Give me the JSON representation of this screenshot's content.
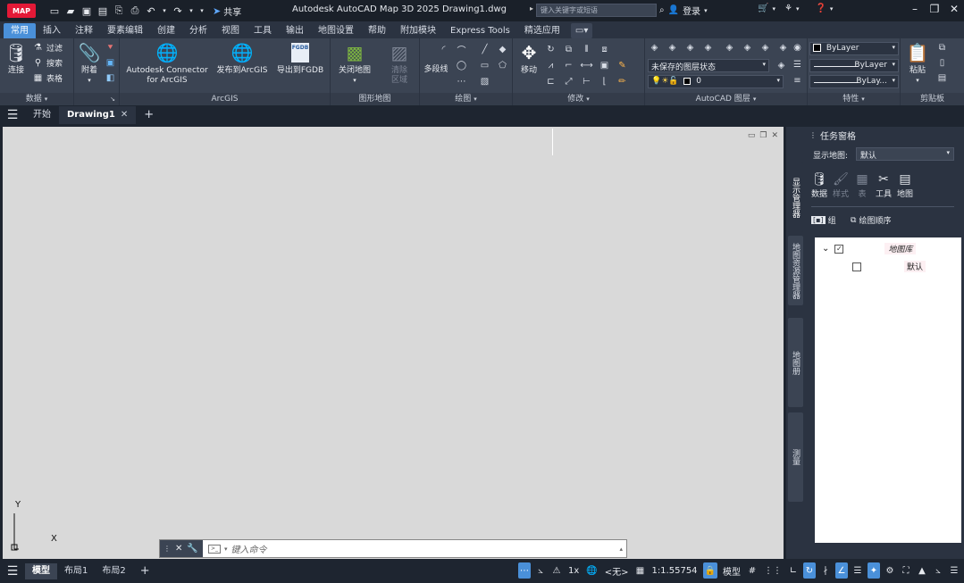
{
  "titlebar": {
    "logo": "MAP",
    "share_label": "共享",
    "window_title": "Autodesk AutoCAD Map 3D 2025    Drawing1.dwg",
    "search_placeholder": "键入关键字或短语",
    "login_label": "登录",
    "qat_icons": [
      "new-icon",
      "open-icon",
      "save-icon",
      "saveas-icon",
      "publish-icon",
      "plot-icon",
      "undo-icon",
      "redo-icon"
    ]
  },
  "ribbon_tabs": [
    "常用",
    "插入",
    "注释",
    "要素编辑",
    "创建",
    "分析",
    "视图",
    "工具",
    "输出",
    "地图设置",
    "帮助",
    "附加模块",
    "Express Tools",
    "精选应用"
  ],
  "ribbon": {
    "data_panel": {
      "title": "数据",
      "connect": "连接",
      "filter": "过滤",
      "search": "搜索",
      "table": "表格"
    },
    "attach_panel": {
      "attach": "附着"
    },
    "arcgis_panel": {
      "title": "ArcGIS",
      "connector": "Autodesk Connector",
      "connector2": "for ArcGIS",
      "publish": "发布到ArcGIS",
      "export": "导出到FGDB",
      "export_badge": "FGDB"
    },
    "mapbook_panel": {
      "title": "图形地图",
      "close_map": "关闭地图",
      "clear_region": "清除",
      "clear_region2": "区域"
    },
    "draw_panel": {
      "title": "绘图",
      "polyline": "多段线"
    },
    "modify_panel": {
      "title": "修改",
      "move": "移动"
    },
    "layers_panel": {
      "title": "AutoCAD 图层",
      "layer_state": "未保存的图层状态",
      "layer_current": "0"
    },
    "properties_panel": {
      "title": "特性",
      "color": "ByLayer",
      "linetype": "ByLayer",
      "lineweight": "ByLay..."
    },
    "clipboard_panel": {
      "title": "剪贴板",
      "paste": "粘贴"
    }
  },
  "filetabs": {
    "start": "开始",
    "drawing": "Drawing1"
  },
  "canvas": {
    "ucs_y": "Y",
    "ucs_x": "X",
    "cmd_placeholder": "键入命令"
  },
  "taskpane": {
    "title": "任务窗格",
    "display_map_label": "显示地图:",
    "display_map_value": "默认",
    "tools": [
      {
        "label": "数据",
        "icon": "data-icon",
        "glyph": "🛢",
        "dim": false
      },
      {
        "label": "样式",
        "icon": "style-icon",
        "glyph": "🖌",
        "dim": true
      },
      {
        "label": "表",
        "icon": "table-icon",
        "glyph": "▦",
        "dim": true
      },
      {
        "label": "工具",
        "icon": "tools-icon",
        "glyph": "✂",
        "dim": false
      },
      {
        "label": "地图",
        "icon": "map-icon",
        "glyph": "▤",
        "dim": false
      }
    ],
    "group_label": "组",
    "draw_order_label": "绘图顺序",
    "side_tabs": [
      "显示管理器",
      "地图资源管理器",
      "地图册",
      "测量"
    ],
    "tree": {
      "root": "地图库",
      "child": "默认"
    }
  },
  "statusbar": {
    "layouts": [
      "模型",
      "布局1",
      "布局2"
    ],
    "model_label": "模型",
    "scale": "1:1.55754",
    "unit": "<无>",
    "anno_scale": "1x"
  }
}
